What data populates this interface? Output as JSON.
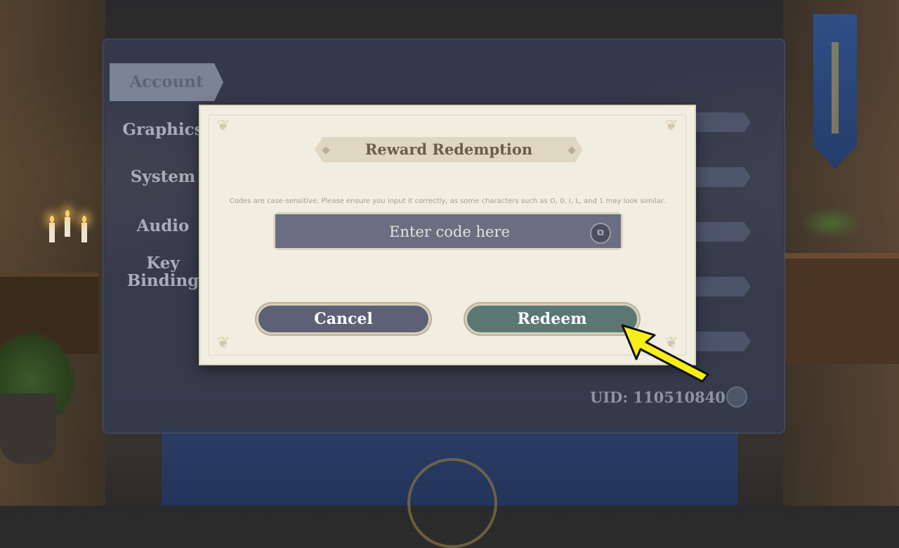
{
  "settings": {
    "nav": {
      "account": "Account",
      "graphics": "Graphics",
      "system": "System",
      "audio": "Audio",
      "key_binding_line1": "Key",
      "key_binding_line2": "Binding"
    },
    "uid_label": "UID: 110510840"
  },
  "dialog": {
    "title": "Reward Redemption",
    "hint": "Codes are case-sensitive. Please ensure you input it correctly, as some characters such as O, 0, I, L, and 1 may look similar.",
    "code_placeholder": "Enter code here",
    "cancel_label": "Cancel",
    "redeem_label": "Redeem"
  },
  "icons": {
    "paste": "paste-icon",
    "copy_uid": "copy-icon",
    "annotation_arrow": "arrow-icon"
  },
  "colors": {
    "annotation_arrow": "#f5ee1a",
    "redeem_button": "#5a7871",
    "cancel_button": "#5e6175"
  }
}
